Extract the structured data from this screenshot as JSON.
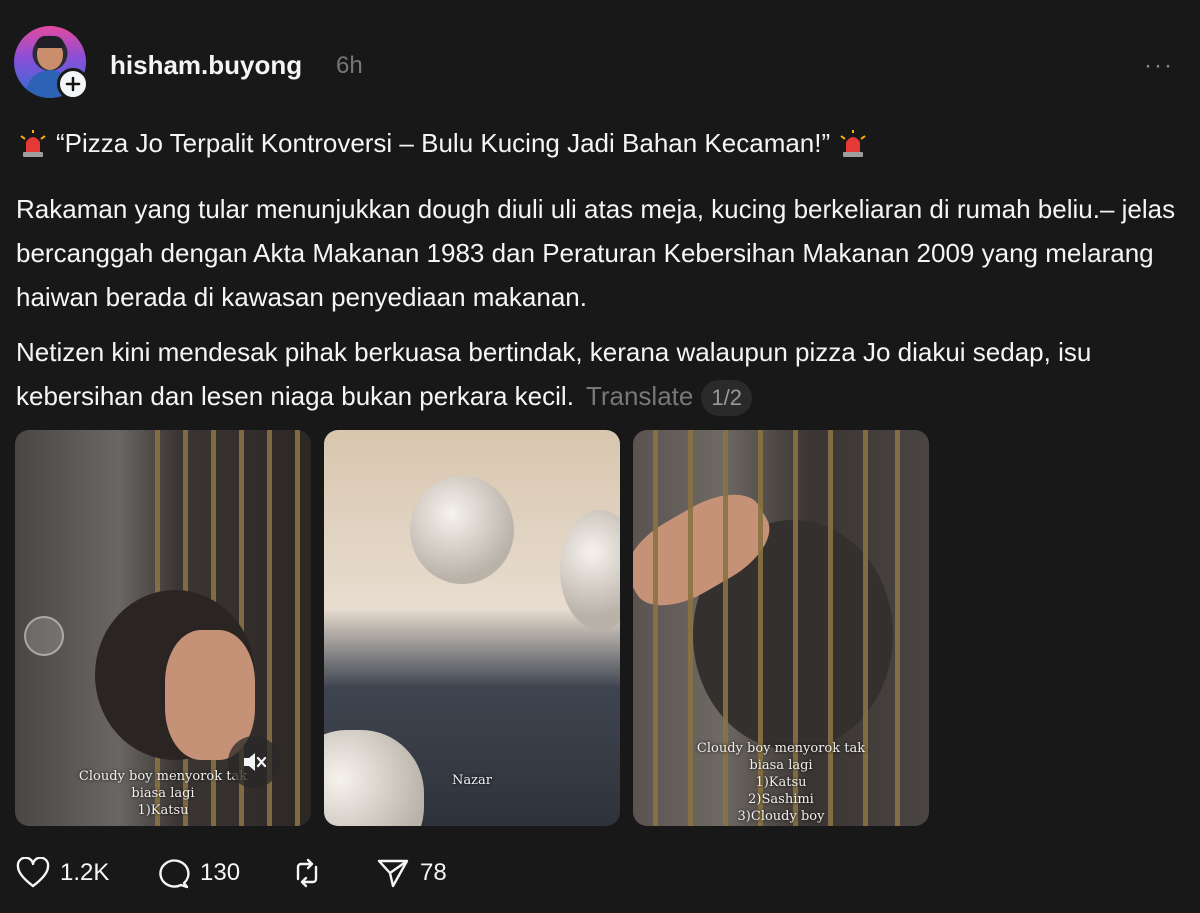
{
  "post": {
    "username": "hisham.buyong",
    "time": "6h",
    "more": "···",
    "headline": "“Pizza Jo Terpalit Kontroversi – Bulu Kucing Jadi Bahan Kecaman!”",
    "paragraph1": "Rakaman yang tular menunjukkan dough diuli uli atas meja, kucing berkeliaran di rumah beliu.– jelas bercanggah dengan Akta Makanan 1983 dan Peraturan Kebersihan Makanan 2009 yang melarang haiwan berada di kawasan penyediaan makanan.",
    "paragraph2": "Netizen kini mendesak pihak berkuasa bertindak, kerana walaupun pizza Jo diakui sedap, isu kebersihan dan lesen niaga bukan perkara kecil.",
    "translate_label": "Translate",
    "pager": "1/2"
  },
  "media": [
    {
      "caption_lines": [
        "Cloudy boy menyorok tak",
        "biasa lagi",
        "1)Katsu"
      ]
    },
    {
      "caption_lines": [
        "Nazar"
      ]
    },
    {
      "caption_lines": [
        "Cloudy boy menyorok tak",
        "biasa lagi",
        "1)Katsu",
        "2)Sashimi",
        "3)Cloudy boy"
      ]
    }
  ],
  "actions": {
    "likes": "1.2K",
    "comments": "130",
    "shares": "78"
  },
  "icons": {
    "headline": "siren-icon",
    "like": "heart-icon",
    "comment": "comment-bubble-icon",
    "repost": "repost-icon",
    "share": "send-icon",
    "follow": "plus-icon",
    "mute": "muted-speaker-icon"
  }
}
